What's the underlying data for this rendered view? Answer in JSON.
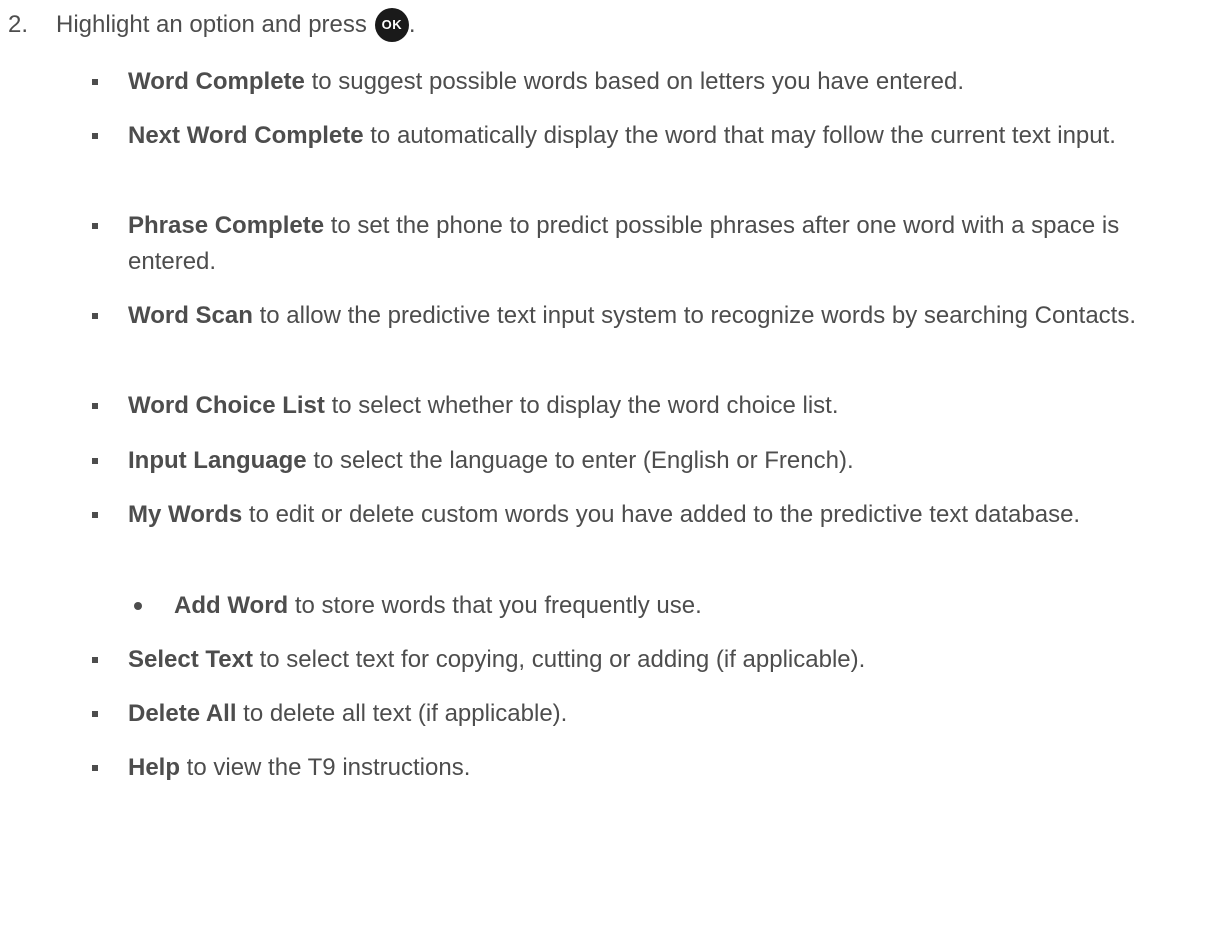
{
  "step": {
    "number": "2.",
    "text_before": "Highlight an option and press",
    "ok_label": "OK",
    "text_after": "."
  },
  "options": [
    {
      "term": "Word Complete",
      "desc": " to suggest possible words based on letters you have entered."
    },
    {
      "term": "Next Word Complete",
      "desc": " to automatically display the word that may follow the current text input."
    },
    {
      "term": "Phrase Complete",
      "desc": " to set the phone to predict possible phrases after one word with a space is entered."
    },
    {
      "term": "Word Scan",
      "desc": " to allow the predictive text input system to recognize words by searching Contacts."
    },
    {
      "term": "Word Choice List",
      "desc": " to select whether to display the word choice list."
    },
    {
      "term": "Input Language",
      "desc": " to select the language to enter (English or French)."
    },
    {
      "term": "My Words",
      "desc": " to edit or delete custom words you have added to the predictive text database."
    },
    {
      "term": "Select Text",
      "desc": " to select text for copying, cutting or adding (if applicable)."
    },
    {
      "term": "Delete All",
      "desc": " to delete all text (if applicable)."
    },
    {
      "term": "Help",
      "desc": " to view the T9 instructions."
    }
  ],
  "sub_options": [
    {
      "term": "Add Word",
      "desc": " to store words that you frequently use."
    }
  ],
  "colors": {
    "text": "#4d4d4d",
    "ok_button": "#1a1a1a"
  }
}
